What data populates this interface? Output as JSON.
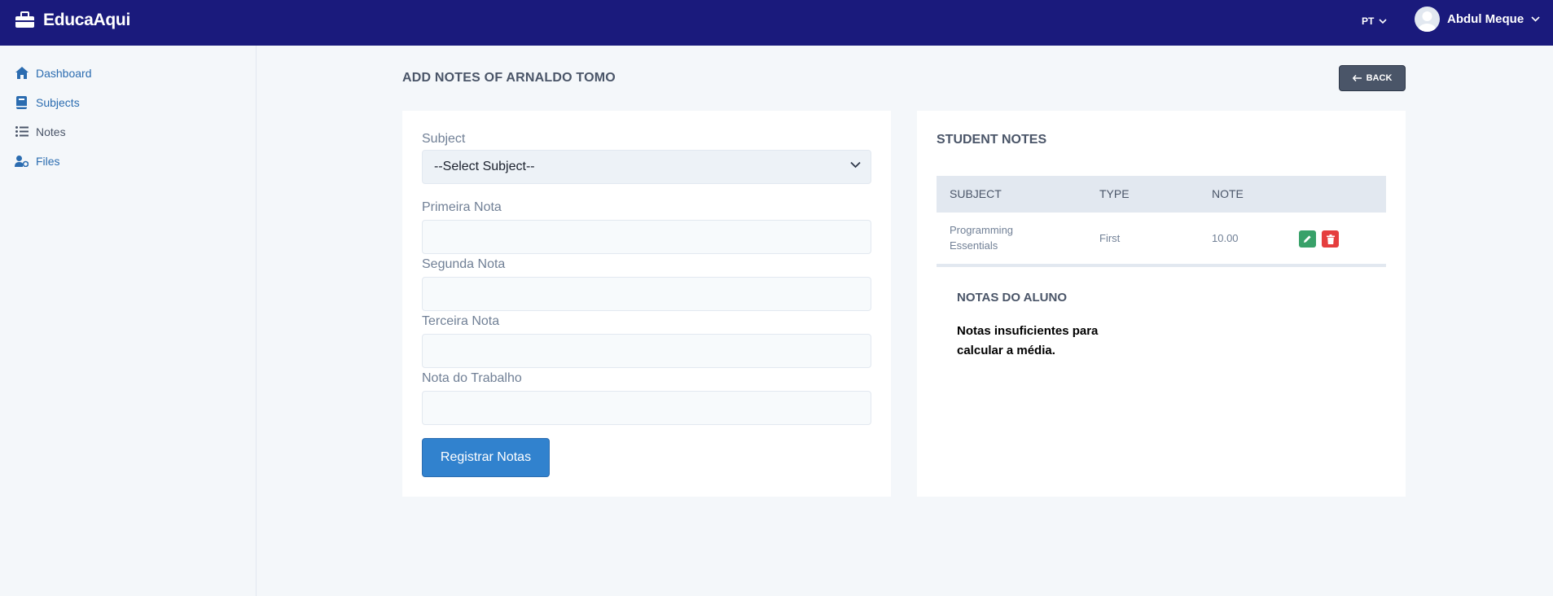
{
  "header": {
    "brand": "EducaAqui",
    "language": "PT",
    "user_name": "Abdul Meque"
  },
  "sidebar": {
    "items": [
      {
        "label": "Dashboard",
        "icon": "home-icon"
      },
      {
        "label": "Subjects",
        "icon": "book-icon"
      },
      {
        "label": "Notes",
        "icon": "list-icon"
      },
      {
        "label": "Files",
        "icon": "user-cog-icon"
      }
    ]
  },
  "main": {
    "title": "ADD NOTES OF ARNALDO TOMO",
    "back_label": "BACK"
  },
  "form": {
    "subject_label": "Subject",
    "subject_selected": "--Select Subject--",
    "first_label": "Primeira Nota",
    "second_label": "Segunda Nota",
    "third_label": "Terceira Nota",
    "work_label": "Nota do Trabalho",
    "submit_label": "Registrar Notas"
  },
  "student_notes": {
    "title": "STUDENT NOTES",
    "columns": [
      "SUBJECT",
      "TYPE",
      "NOTE"
    ],
    "rows": [
      {
        "subject_line1": "Programming",
        "subject_line2": "Essentials",
        "type": "First",
        "note": "10.00"
      }
    ],
    "average_title": "NOTAS DO ALUNO",
    "average_message": "Notas insuficientes para calcular a média."
  },
  "colors": {
    "topbar": "#1a1a7c",
    "primary": "#3182ce",
    "edit": "#38a169",
    "delete": "#e53e3e"
  }
}
